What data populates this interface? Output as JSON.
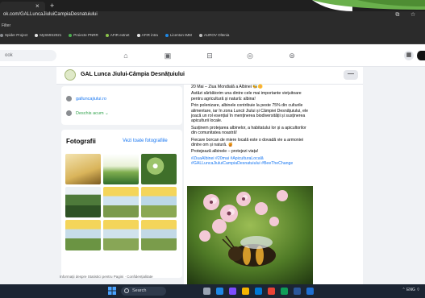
{
  "browser": {
    "tab_close": "×",
    "tab_new": "+",
    "url": "ok.com/GALLuncaJiuluiCampiaDesnatuiului",
    "addr_icons": "⧉ ☆",
    "bookmarks_left": "Filter",
    "bookmarks": [
      {
        "label": "Spider Project",
        "color": "#8a8d91"
      },
      {
        "label": "MySMIS2021",
        "color": "#e4e4e4"
      },
      {
        "label": "Proiecte PNRR",
        "color": "#4caf50"
      },
      {
        "label": "AFIR extnet",
        "color": "#8bc34a"
      },
      {
        "label": "AFIR intra",
        "color": "#e4e4e4"
      },
      {
        "label": "Licenton IMM",
        "color": "#1e88e5"
      },
      {
        "label": "AUROV Oltenia",
        "color": "#bdbdbd"
      }
    ]
  },
  "fb": {
    "search_placeholder": "ook",
    "nav_icons": [
      "home-icon",
      "video-icon",
      "marketplace-icon",
      "groups-icon",
      "gaming-icon"
    ],
    "menu_icon": "▦"
  },
  "page": {
    "name": "GAL Lunca Jiului-Câmpia Desnățuiului",
    "more_label": "—"
  },
  "intro": {
    "website": "galluncajiului.ro",
    "open_status": "Deschis acum ⌄"
  },
  "photos": {
    "title": "Fotografii",
    "see_all": "Vezi toate fotografiile"
  },
  "footer": "Informații despre Statistici pentru Pagini · Confidențialitate",
  "post": {
    "line1": "20 Mai – Ziua Mondială a Albinei 🐝🌼",
    "para1": "Astăzi sărbătorim una dintre cele mai importante viețuitoare pentru agricultură și natură: albina!",
    "para2": "Prin polenizare, albinele contribuie la peste 75% din culturile alimentare, iar în zona Luncii Jiului și Câmpiei Desnățuiului, ele joacă un rol esențial în menținerea biodiversității și susținerea apiculturii locale.",
    "para3": "Susținem protejarea albinelor, a habitatului lor și a apicultorilor din comunitatea noastră!",
    "para4": "Fiecare borcan de miere locală este o dovadă vie a armoniei dintre om și natură. 🍯",
    "para5": "Protejează albinele – protejezi viața!",
    "tags": "#ZiuaAlbinei #20mai #ApiculturaLocală #GALLuncaJiuluiCampiaDesnatuiului #BeeTheChange"
  },
  "taskbar": {
    "search_label": "Search",
    "tray": "⌃  ENG  ⌔"
  }
}
